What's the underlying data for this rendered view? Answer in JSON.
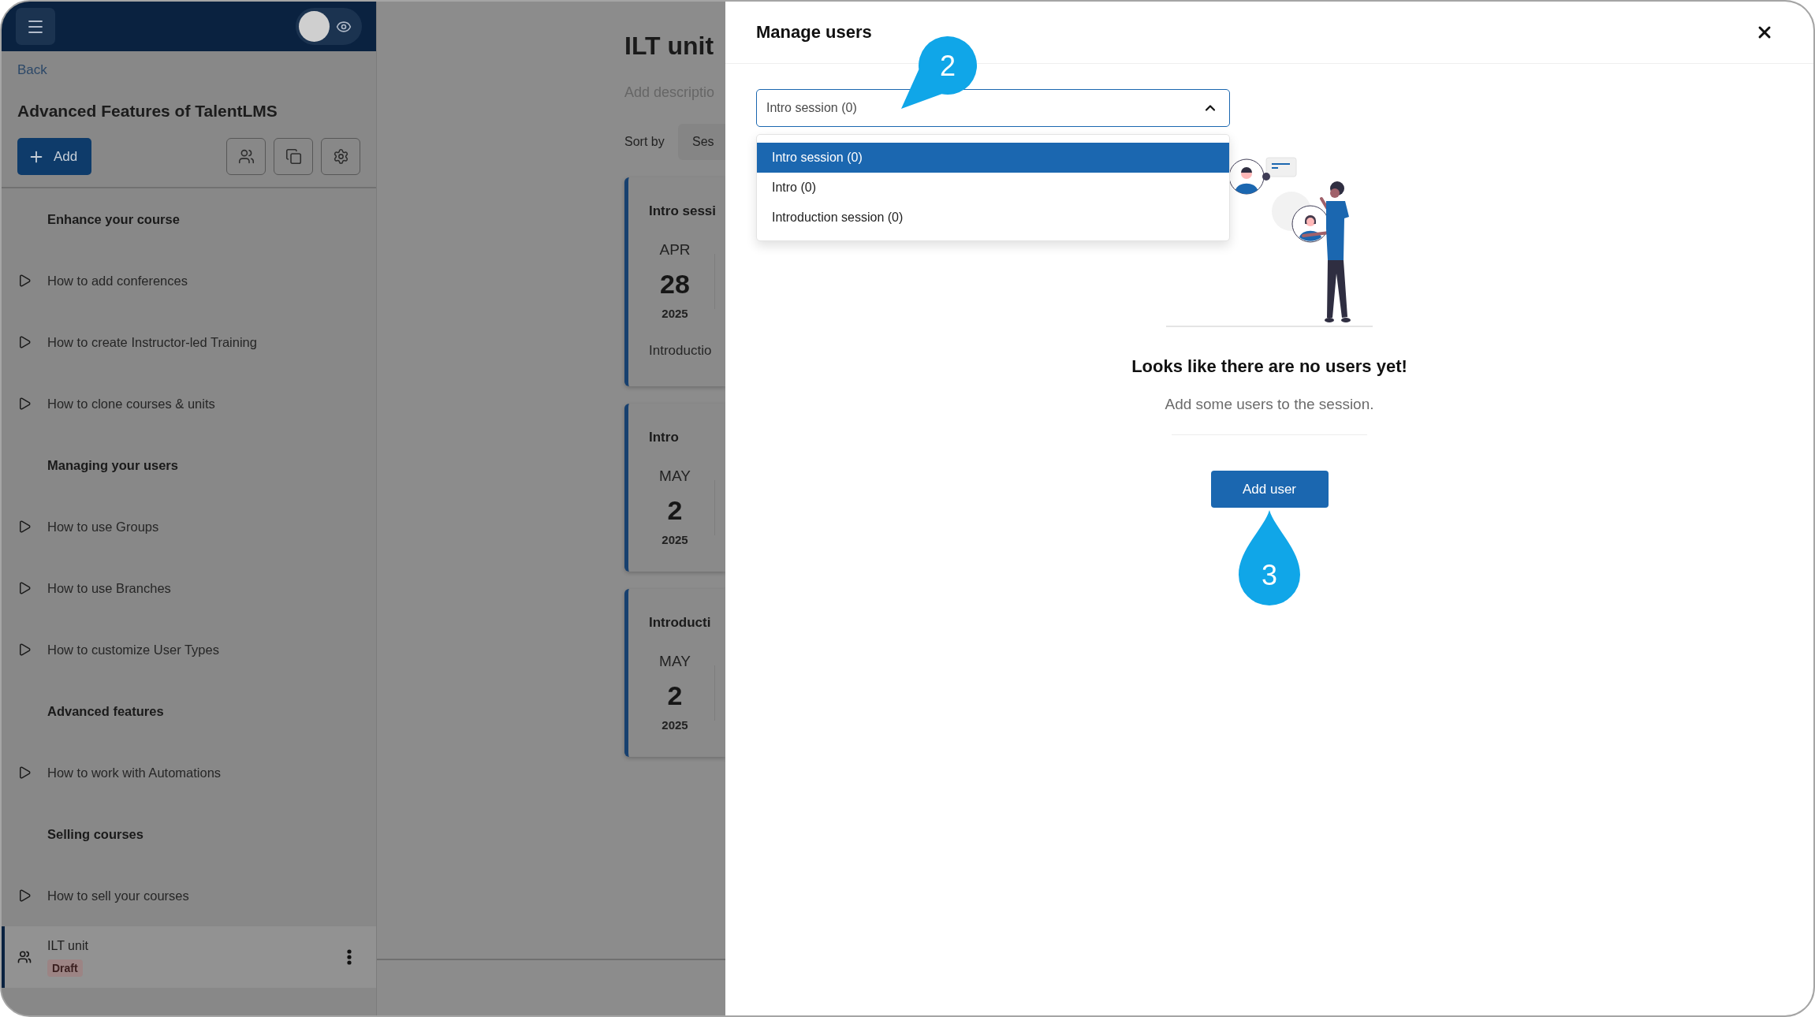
{
  "sidebar": {
    "back_link": "Back",
    "course_title": "Advanced Features of TalentLMS",
    "add_button": "Add",
    "preview_toggle": {
      "on": false
    },
    "items": [
      {
        "kind": "section",
        "title": "Enhance your course"
      },
      {
        "kind": "video",
        "title": "How to add conferences",
        "selected": false
      },
      {
        "kind": "video",
        "title": "How to create Instructor-led Training",
        "selected": false
      },
      {
        "kind": "video",
        "title": "How to clone courses & units",
        "selected": false
      },
      {
        "kind": "section",
        "title": "Managing your users"
      },
      {
        "kind": "video",
        "title": "How to use Groups",
        "selected": false
      },
      {
        "kind": "video",
        "title": "How to use Branches",
        "selected": false
      },
      {
        "kind": "video",
        "title": "How to customize User Types",
        "selected": false
      },
      {
        "kind": "section",
        "title": "Advanced features"
      },
      {
        "kind": "video",
        "title": "How to work with Automations",
        "selected": false
      },
      {
        "kind": "section",
        "title": "Selling courses"
      },
      {
        "kind": "video",
        "title": "How to sell your courses",
        "selected": false
      },
      {
        "kind": "ilt",
        "title": "ILT unit",
        "badge": "Draft",
        "selected": true
      }
    ]
  },
  "main": {
    "title": "ILT unit",
    "description": {
      "placeholder": "Add descriptio"
    },
    "sort": {
      "label": "Sort by",
      "value": "Ses"
    },
    "sessions": [
      {
        "title": "Intro sessi",
        "month": "APR",
        "day": "28",
        "year": "2025",
        "description": "Introductio"
      },
      {
        "title": "Intro",
        "month": "MAY",
        "day": "2",
        "year": "2025"
      },
      {
        "title": "Introducti",
        "month": "MAY",
        "day": "2",
        "year": "2025"
      }
    ]
  },
  "modal": {
    "title": "Manage users",
    "session_select": {
      "value": "Intro session (0)",
      "expanded": true,
      "annotation": "2",
      "options": [
        {
          "label": "Intro session (0)",
          "selected": true
        },
        {
          "label": "Intro (0)",
          "selected": false
        },
        {
          "label": "Introduction session (0)",
          "selected": false
        }
      ]
    },
    "empty_state": {
      "title": "Looks like there are no users yet!",
      "text": "Add some users to the session."
    },
    "add_user_button": {
      "label": "Add user",
      "annotation": "3"
    }
  }
}
